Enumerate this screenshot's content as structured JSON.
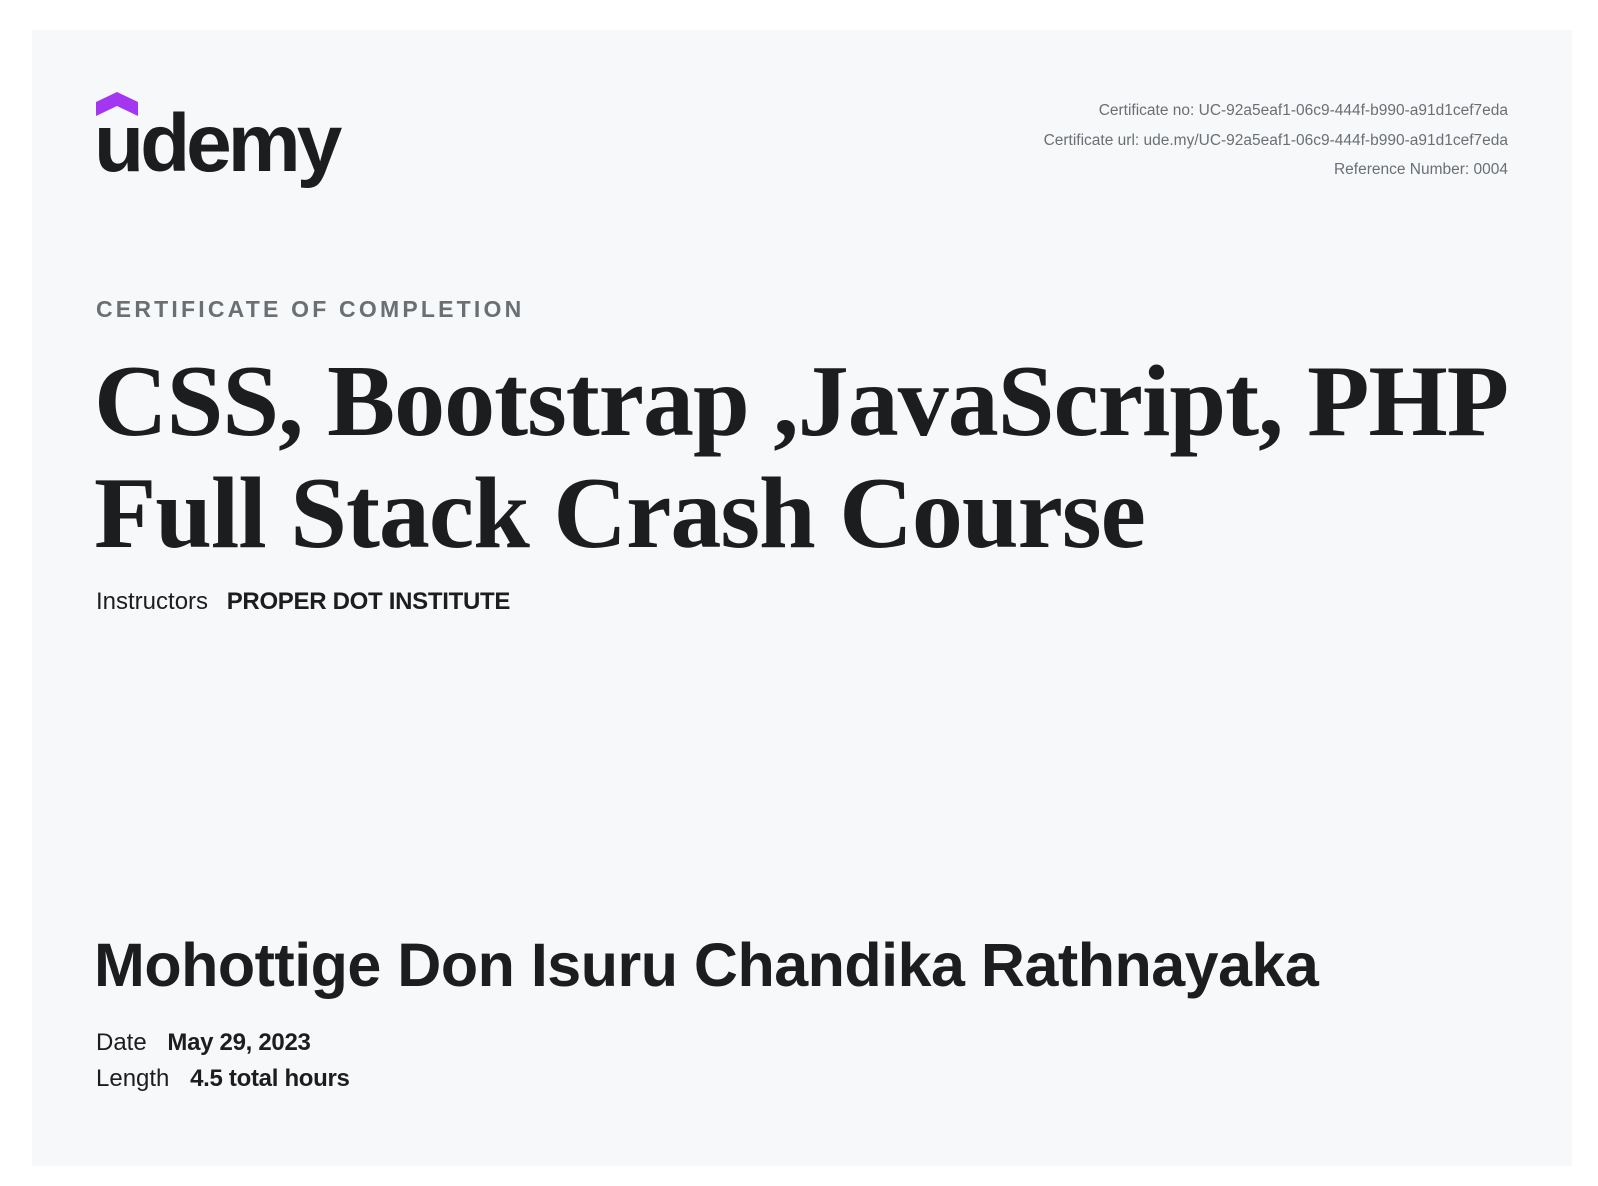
{
  "brand": {
    "logo_text": "udemy",
    "accent_color": "#a435f0",
    "text_color": "#1c1d1f"
  },
  "meta": {
    "certificate_no": "Certificate no: UC-92a5eaf1-06c9-444f-b990-a91d1cef7eda",
    "certificate_url": "Certificate url: ude.my/UC-92a5eaf1-06c9-444f-b990-a91d1cef7eda",
    "reference_number": "Reference Number: 0004"
  },
  "certificate": {
    "label": "CERTIFICATE OF COMPLETION",
    "course_title": "CSS, Bootstrap ,JavaScript, PHP Full Stack Crash Course",
    "instructors_label": "Instructors",
    "instructors_value": "PROPER DOT INSTITUTE",
    "student_name": "Mohottige Don Isuru Chandika Rathnayaka",
    "date_label": "Date",
    "date_value": "May 29, 2023",
    "length_label": "Length",
    "length_value": "4.5 total hours"
  }
}
